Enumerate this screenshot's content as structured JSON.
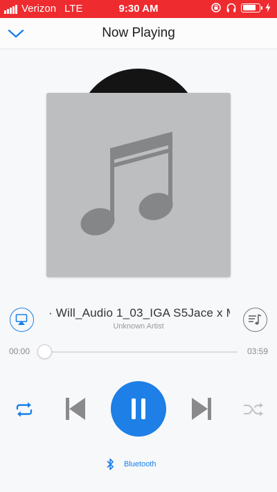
{
  "status_bar": {
    "carrier": "Verizon",
    "network": "LTE",
    "time": "9:30 AM"
  },
  "header": {
    "title": "Now Playing"
  },
  "track": {
    "title": "· Will_Audio 1_03_IGA S5Jace x M",
    "artist": "Unknown Artist"
  },
  "progress": {
    "elapsed": "00:00",
    "total": "03:59",
    "fraction": 0.0
  },
  "bluetooth": {
    "label": "Bluetooth"
  },
  "colors": {
    "status_bar": "#ee2b2f",
    "accent": "#1e7fe6",
    "artwork_bg": "#bdbebf",
    "note": "#858687",
    "control_gray": "#8a8a8d"
  },
  "icons": {
    "back": "chevron-down-icon",
    "airplay": "airplay-icon",
    "queue": "playlist-icon",
    "repeat": "repeat-icon",
    "previous": "skip-previous-icon",
    "play_pause": "pause-icon",
    "next": "skip-next-icon",
    "shuffle": "shuffle-icon",
    "bluetooth": "bluetooth-icon"
  }
}
